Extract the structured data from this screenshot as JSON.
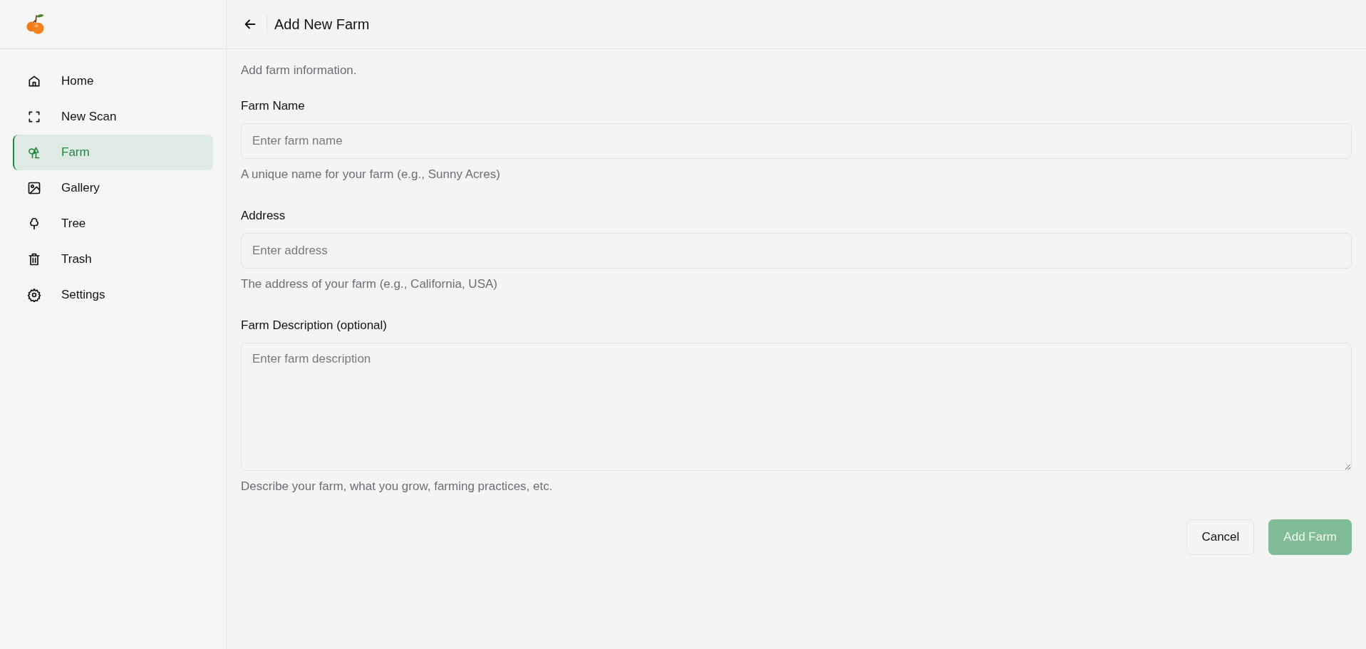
{
  "sidebar": {
    "items": [
      {
        "label": "Home",
        "kind": "home",
        "selected": false
      },
      {
        "label": "New Scan",
        "kind": "scan",
        "selected": false
      },
      {
        "label": "Farm",
        "kind": "farm",
        "selected": true
      },
      {
        "label": "Gallery",
        "kind": "gallery",
        "selected": false
      },
      {
        "label": "Tree",
        "kind": "tree",
        "selected": false
      },
      {
        "label": "Trash",
        "kind": "trash",
        "selected": false
      },
      {
        "label": "Settings",
        "kind": "settings",
        "selected": false
      }
    ]
  },
  "header": {
    "title": "Add New Farm"
  },
  "form": {
    "intro": "Add farm information.",
    "fields": [
      {
        "kind": "input",
        "label": "Farm Name",
        "placeholder": "Enter farm name",
        "helper": "A unique name for your farm (e.g., Sunny Acres)"
      },
      {
        "kind": "input",
        "label": "Address",
        "placeholder": "Enter address",
        "helper": "The address of your farm (e.g., California, USA)"
      },
      {
        "kind": "textarea",
        "label": "Farm Description (optional)",
        "placeholder": "Enter farm description",
        "helper": "Describe your farm, what you grow, farming practices, etc."
      }
    ],
    "buttons": [
      {
        "kind": "secondary",
        "label": "Cancel",
        "disabled": false
      },
      {
        "kind": "primary",
        "label": "Add Farm",
        "disabled": true
      }
    ]
  }
}
